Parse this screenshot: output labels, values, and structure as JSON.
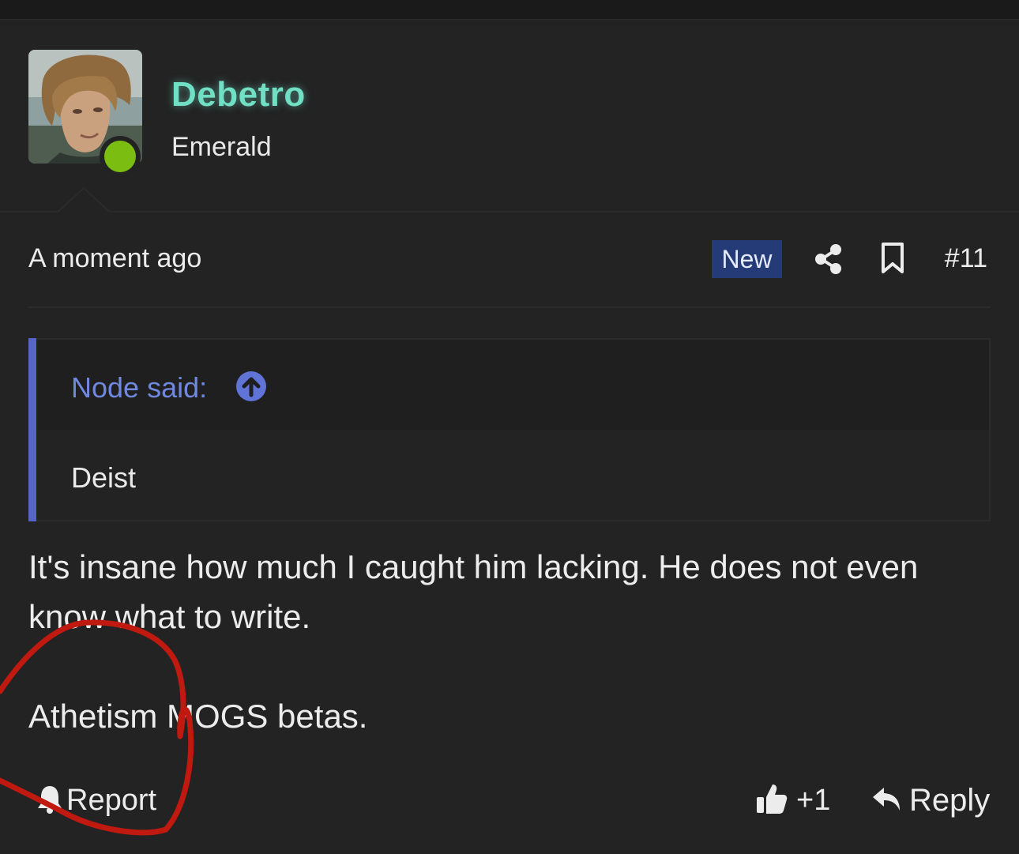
{
  "user": {
    "name": "Debetro",
    "title": "Emerald",
    "online": true
  },
  "post": {
    "timestamp": "A moment ago",
    "badge": "New",
    "number": "#11",
    "quote": {
      "author_line": "Node said:",
      "text": "Deist"
    },
    "paragraphs": [
      "It's insane how much I caught him lacking. He does not even know what to write.",
      "Athetism MOGS betas."
    ]
  },
  "actions": {
    "report_label": "Report",
    "like_count": "+1",
    "reply_label": "Reply"
  },
  "icons": {
    "share": "share-icon",
    "bookmark": "bookmark-icon",
    "quote_jump": "arrow-up-circle-icon",
    "report": "bell-icon",
    "like": "thumbs-up-icon",
    "reply": "reply-arrow-icon"
  },
  "colors": {
    "background": "#232323",
    "username": "#70dfc4",
    "online_dot": "#7cbd12",
    "badge_bg": "#243b78",
    "quote_accent": "#5765c6",
    "quote_author": "#7088dd",
    "annotation_circle": "#c0190f"
  }
}
